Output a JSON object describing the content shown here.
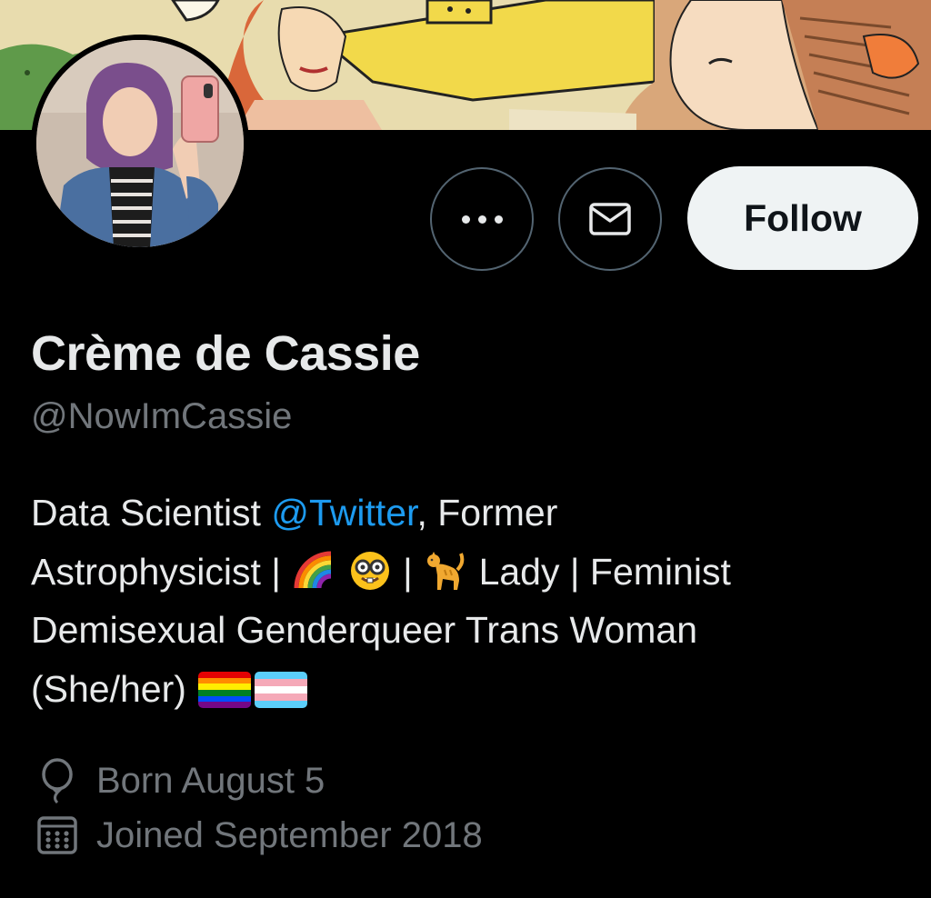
{
  "profile": {
    "display_name": "Crème de Cassie",
    "handle": "@NowImCassie"
  },
  "actions": {
    "more_icon": "more-horizontal-icon",
    "message_icon": "envelope-icon",
    "follow_label": "Follow"
  },
  "bio": {
    "line1_text": "Data Scientist ",
    "line1_mention": "@Twitter",
    "line1_rest": ", Former",
    "line2_a": "Astrophysicist | ",
    "line2_b": " | ",
    "line2_c": " Lady | Feminist",
    "line3": "Demisexual Genderqueer Trans Woman",
    "line4": "(She/her) ",
    "emojis": [
      "rainbow-emoji",
      "nerd-face-emoji",
      "cat-emoji",
      "rainbow-flag-emoji",
      "transgender-flag-emoji"
    ]
  },
  "meta": {
    "born_icon": "balloon-icon",
    "born": "Born August 5",
    "joined_icon": "calendar-icon",
    "joined": "Joined September 2018"
  },
  "colors": {
    "background": "#000000",
    "primary_text": "#e7e9ea",
    "secondary_text": "#71767b",
    "link": "#1d9bf0",
    "follow_button_bg": "#eff3f4",
    "follow_button_text": "#0f1419",
    "button_border": "#536471"
  }
}
